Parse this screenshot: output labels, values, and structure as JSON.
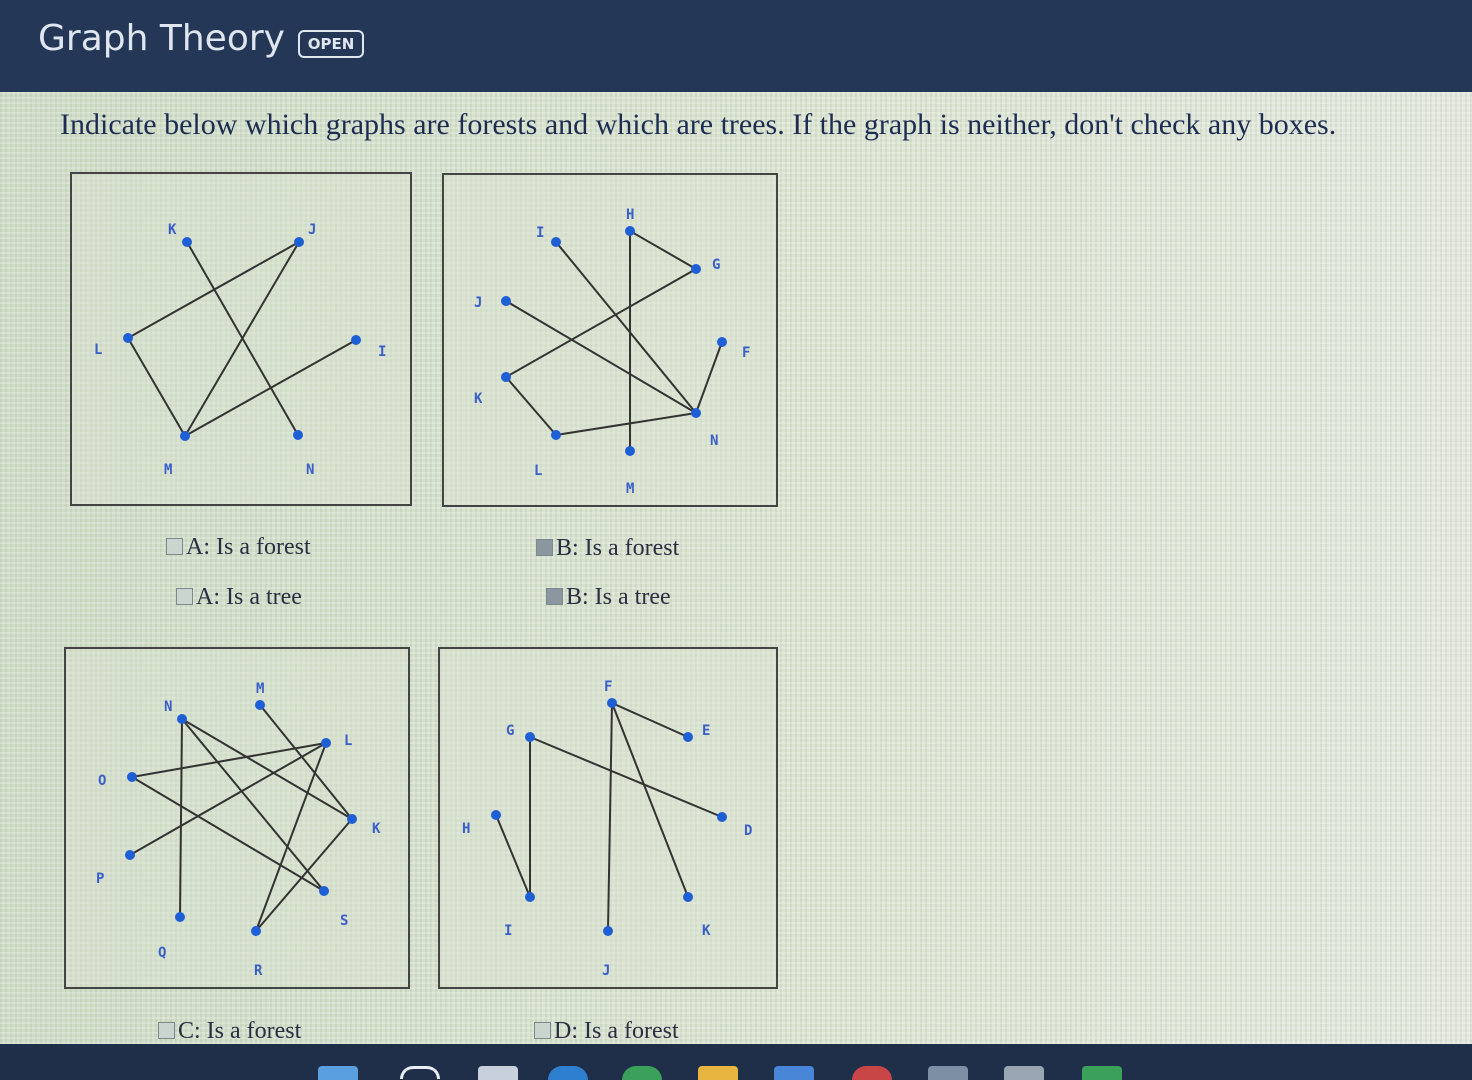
{
  "header": {
    "title": "Graph Theory",
    "badge": "OPEN"
  },
  "prompt": "Indicate below which graphs are forests and which are trees. If the graph is neither, don't check any boxes.",
  "colors": {
    "edge": "#333333",
    "vertex": "#1f5fd6",
    "label": "#3a5fc9"
  },
  "graphs": {
    "A": {
      "vertex_labels": [
        "K",
        "J",
        "L",
        "I",
        "M",
        "N"
      ],
      "options": [
        "A: Is a forest",
        "A: Is a tree"
      ]
    },
    "B": {
      "vertex_labels": [
        "H",
        "I",
        "G",
        "J",
        "F",
        "K",
        "N",
        "L",
        "M"
      ],
      "options": [
        "B: Is a forest",
        "B: Is a tree"
      ]
    },
    "C": {
      "vertex_labels": [
        "M",
        "N",
        "L",
        "O",
        "K",
        "P",
        "S",
        "Q",
        "R"
      ],
      "options": [
        "C: Is a forest"
      ]
    },
    "D": {
      "vertex_labels": [
        "F",
        "G",
        "E",
        "H",
        "D",
        "I",
        "K",
        "J"
      ],
      "options": [
        "D: Is a forest"
      ]
    }
  }
}
